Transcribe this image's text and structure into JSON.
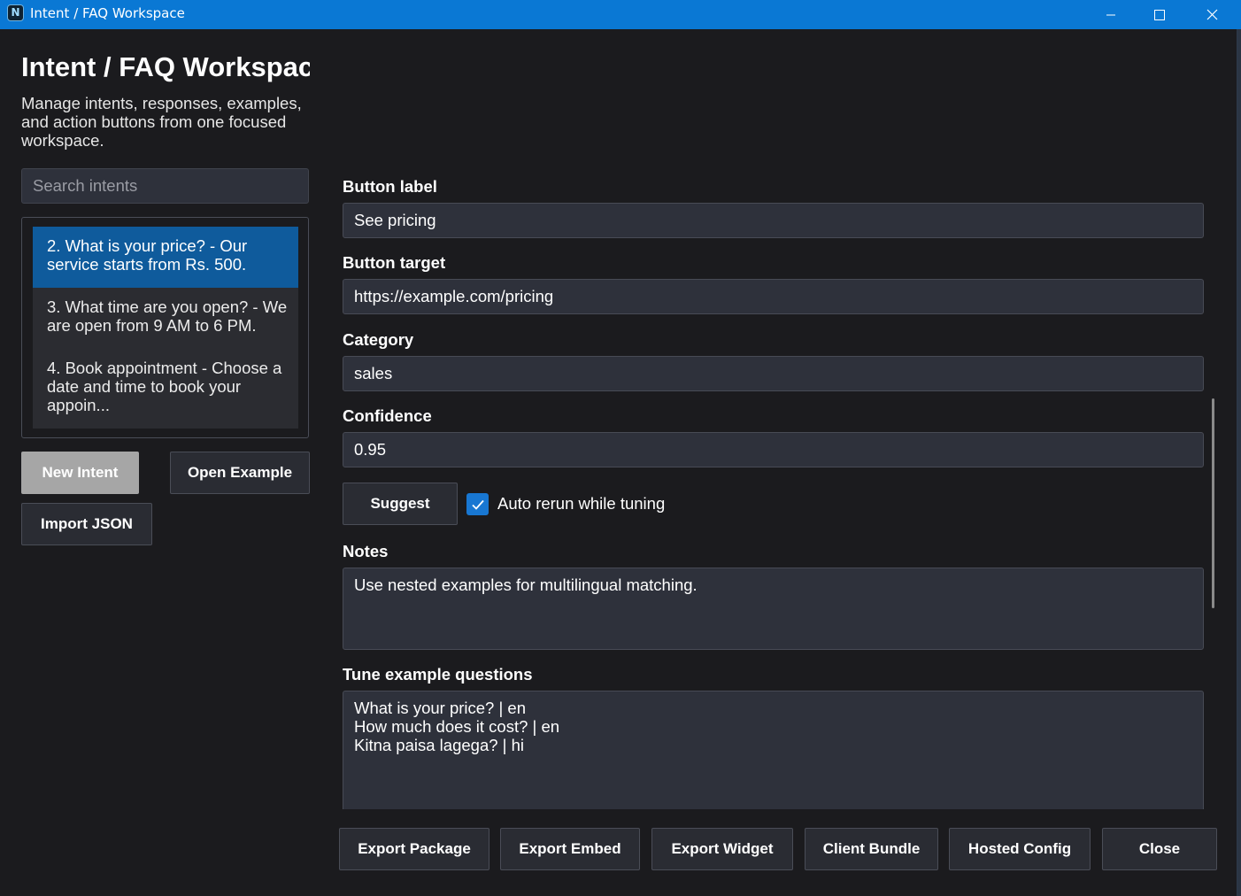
{
  "window": {
    "title": "Intent / FAQ Workspace",
    "accent": "#0a78d4",
    "app_icon_glyph": "N",
    "controls": [
      "minimize-icon",
      "maximize-icon",
      "close-icon"
    ]
  },
  "header": {
    "title": "Intent / FAQ Workspace",
    "subtitle": "Manage intents, responses, examples, and action buttons from one focused workspace."
  },
  "search": {
    "placeholder": "Search intents",
    "value": ""
  },
  "intents": [
    {
      "label": "2. What is your price? - Our service starts from Rs. 500.",
      "selected": true
    },
    {
      "label": "3. What time are you open? - We are open from 9 AM to 6 PM.",
      "selected": false
    },
    {
      "label": "4. Book appointment - Choose a date and time to book your appoin...",
      "selected": false
    }
  ],
  "left_buttons": {
    "new_intent": "New Intent",
    "open_example": "Open Example",
    "import_json": "Import JSON"
  },
  "form": {
    "button_label": {
      "label": "Button label",
      "value": "See pricing"
    },
    "button_target": {
      "label": "Button target",
      "value": "https://example.com/pricing"
    },
    "category": {
      "label": "Category",
      "value": "sales"
    },
    "confidence": {
      "label": "Confidence",
      "value": "0.95"
    },
    "suggest_label": "Suggest",
    "auto_rerun": {
      "label": "Auto rerun while tuning",
      "checked": true
    },
    "notes": {
      "label": "Notes",
      "value": "Use nested examples for multilingual matching."
    },
    "examples": {
      "label": "Tune example questions",
      "value": "What is your price? | en\nHow much does it cost? | en\nKitna paisa lagega? | hi"
    }
  },
  "footer_buttons": {
    "export_package": "Export Package",
    "export_embed": "Export Embed",
    "export_widget": "Export Widget",
    "client_bundle": "Client Bundle",
    "hosted_config": "Hosted Config",
    "close": "Close"
  }
}
